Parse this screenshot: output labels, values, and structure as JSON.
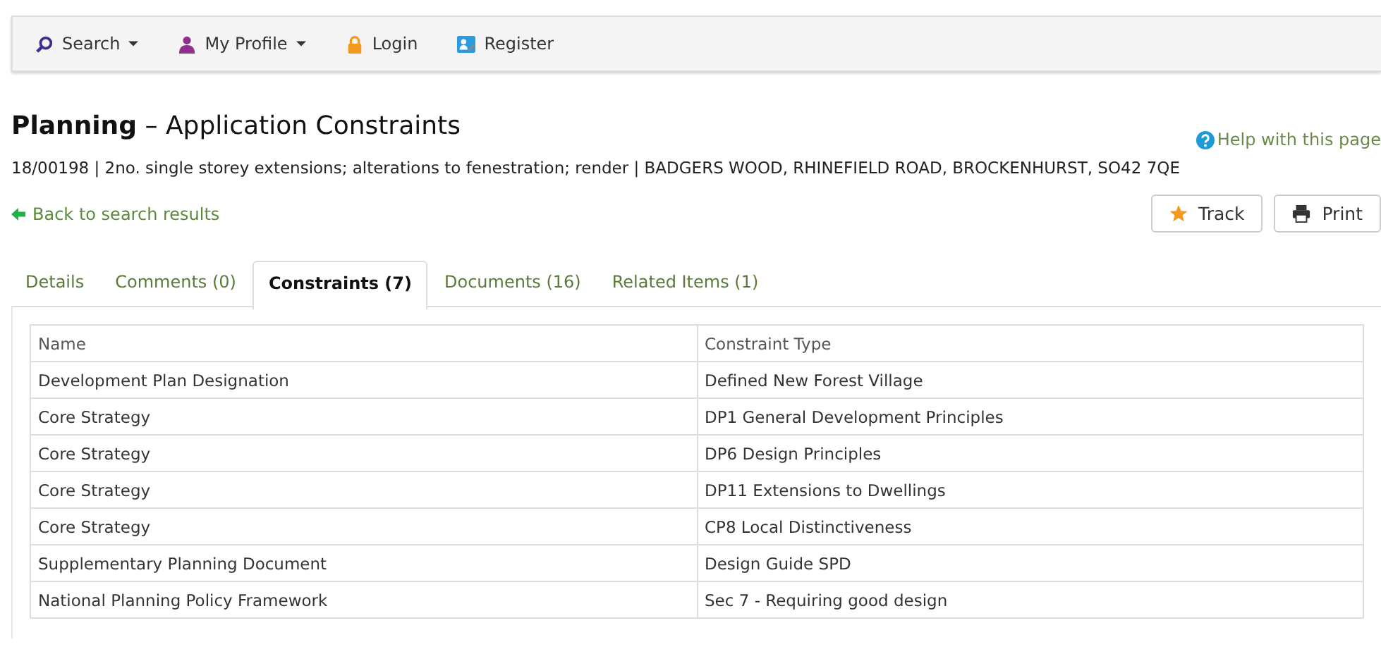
{
  "nav": [
    {
      "kind": "search",
      "label": "Search",
      "dropdown": true
    },
    {
      "kind": "profile",
      "label": "My Profile",
      "dropdown": true
    },
    {
      "kind": "login",
      "label": "Login",
      "dropdown": false
    },
    {
      "kind": "register",
      "label": "Register",
      "dropdown": false
    }
  ],
  "title": "**Planning** – Application Constraints",
  "help_link": "Help with this page",
  "summary": "18/00198 | 2no. single storey extensions; alterations to fenestration; render | BADGERS WOOD, RHINEFIELD ROAD, BROCKENHURST, SO42 7QE",
  "back_link": "Back to search results",
  "actions": [
    {
      "kind": "track",
      "label": "Track"
    },
    {
      "kind": "print",
      "label": "Print"
    }
  ],
  "tabs": [
    {
      "label": "Details",
      "selected": false
    },
    {
      "label": "Comments (0)",
      "selected": false
    },
    {
      "label": "Constraints (7)",
      "selected": true
    },
    {
      "label": "Documents (16)",
      "selected": false
    },
    {
      "label": "Related Items (1)",
      "selected": false
    }
  ],
  "table": {
    "columns": [
      "Name",
      "Constraint Type"
    ],
    "rows": [
      [
        "Development Plan Designation",
        "Defined New Forest Village"
      ],
      [
        "Core Strategy",
        "DP1 General Development Principles"
      ],
      [
        "Core Strategy",
        "DP6 Design Principles"
      ],
      [
        "Core Strategy",
        "DP11 Extensions to Dwellings"
      ],
      [
        "Core Strategy",
        "CP8 Local Distinctiveness"
      ],
      [
        "Supplementary Planning Document",
        "Design Guide SPD"
      ],
      [
        "National Planning Policy Framework",
        "Sec 7 - Requiring good design"
      ]
    ]
  }
}
